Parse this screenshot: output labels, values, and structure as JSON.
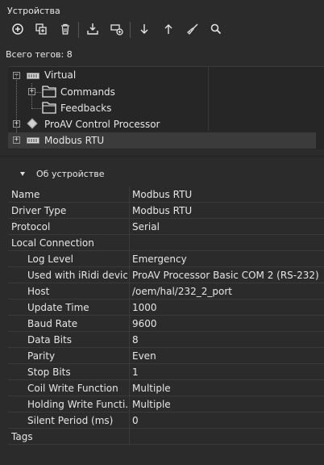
{
  "header": {
    "title": "Устройства"
  },
  "toolbar": {
    "buttons": [
      {
        "name": "add-icon"
      },
      {
        "name": "duplicate-icon"
      },
      {
        "name": "delete-icon"
      },
      {
        "name": "import-icon"
      },
      {
        "name": "add-device-icon"
      },
      {
        "name": "move-down-icon"
      },
      {
        "name": "move-up-icon"
      },
      {
        "name": "clear-icon"
      },
      {
        "name": "search-icon"
      }
    ]
  },
  "tag_count": "Всего тегов: 8",
  "tree": {
    "items": [
      {
        "label": "Virtual",
        "expander": "−",
        "icon": "device-icon"
      },
      {
        "label": "Commands",
        "expander": "+",
        "icon": "folder-icon"
      },
      {
        "label": "Feedbacks",
        "expander": "",
        "icon": "folder-icon"
      },
      {
        "label": "ProAV Control Processor",
        "expander": "+",
        "icon": "diamond-icon"
      },
      {
        "label": "Modbus RTU",
        "expander": "+",
        "icon": "device-icon"
      }
    ]
  },
  "section": {
    "title": "Об устройстве"
  },
  "properties": [
    {
      "name": "Name",
      "value": "Modbus RTU"
    },
    {
      "name": "Driver Type",
      "value": "Modbus RTU"
    },
    {
      "name": "Protocol",
      "value": "Serial"
    },
    {
      "name": "Local Connection",
      "value": ""
    },
    {
      "name": "Log Level",
      "value": "Emergency"
    },
    {
      "name": "Used with iRidi device",
      "value": "ProAV Processor Basic COM 2 (RS-232)"
    },
    {
      "name": "Host",
      "value": "/oem/hal/232_2_port"
    },
    {
      "name": "Update Time",
      "value": "1000"
    },
    {
      "name": "Baud Rate",
      "value": "9600"
    },
    {
      "name": "Data Bits",
      "value": "8"
    },
    {
      "name": "Parity",
      "value": "Even"
    },
    {
      "name": "Stop Bits",
      "value": "1"
    },
    {
      "name": "Coil Write Function",
      "value": "Multiple"
    },
    {
      "name": "Holding Write Functi...",
      "value": "Multiple"
    },
    {
      "name": "Silent Period (ms)",
      "value": "0"
    },
    {
      "name": "Tags",
      "value": ""
    }
  ]
}
